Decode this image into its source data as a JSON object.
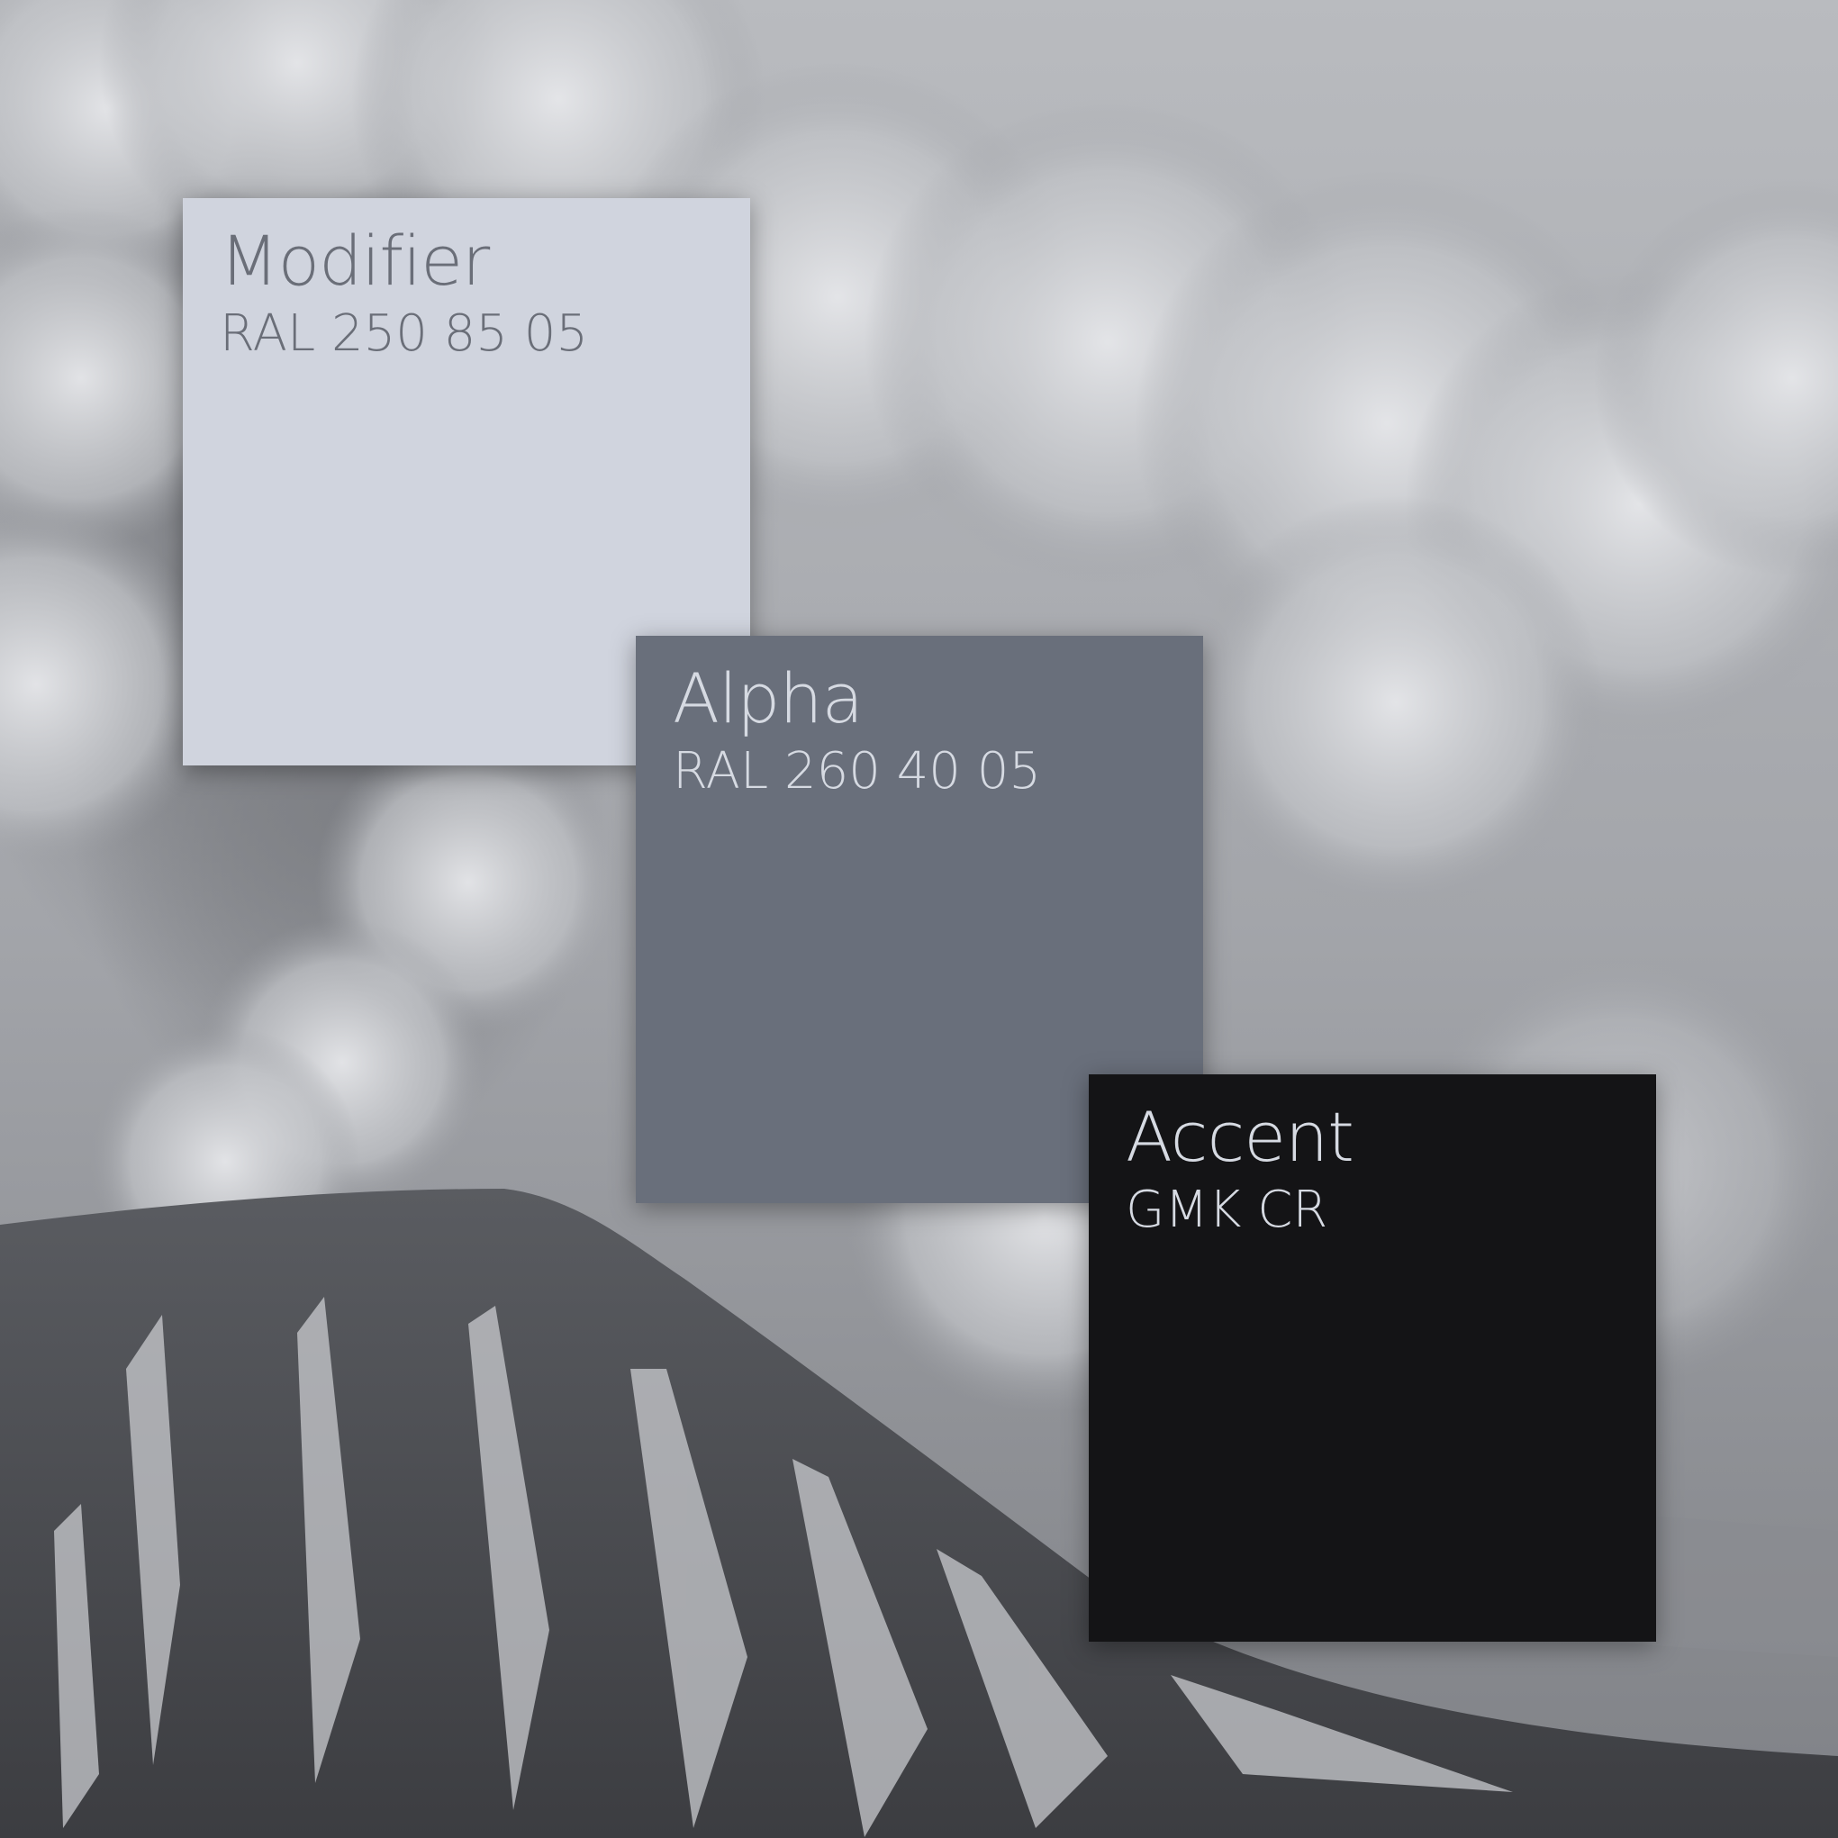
{
  "swatches": [
    {
      "name": "Modifier",
      "code": "RAL 250 85 05",
      "color": "#d0d4de",
      "text_color": "#6a6e78"
    },
    {
      "name": "Alpha",
      "code": "RAL 260 40 05",
      "color": "#696f7b",
      "text_color": "#d6dae2"
    },
    {
      "name": "Accent",
      "code": "GMK CR",
      "color": "#141416",
      "text_color": "#d6dae2"
    }
  ],
  "background": {
    "subject": "erupting volcano with ash plume",
    "palette": [
      "#5f6166",
      "#9a9ca0",
      "#c9cbcf",
      "#2b2c2f"
    ]
  }
}
